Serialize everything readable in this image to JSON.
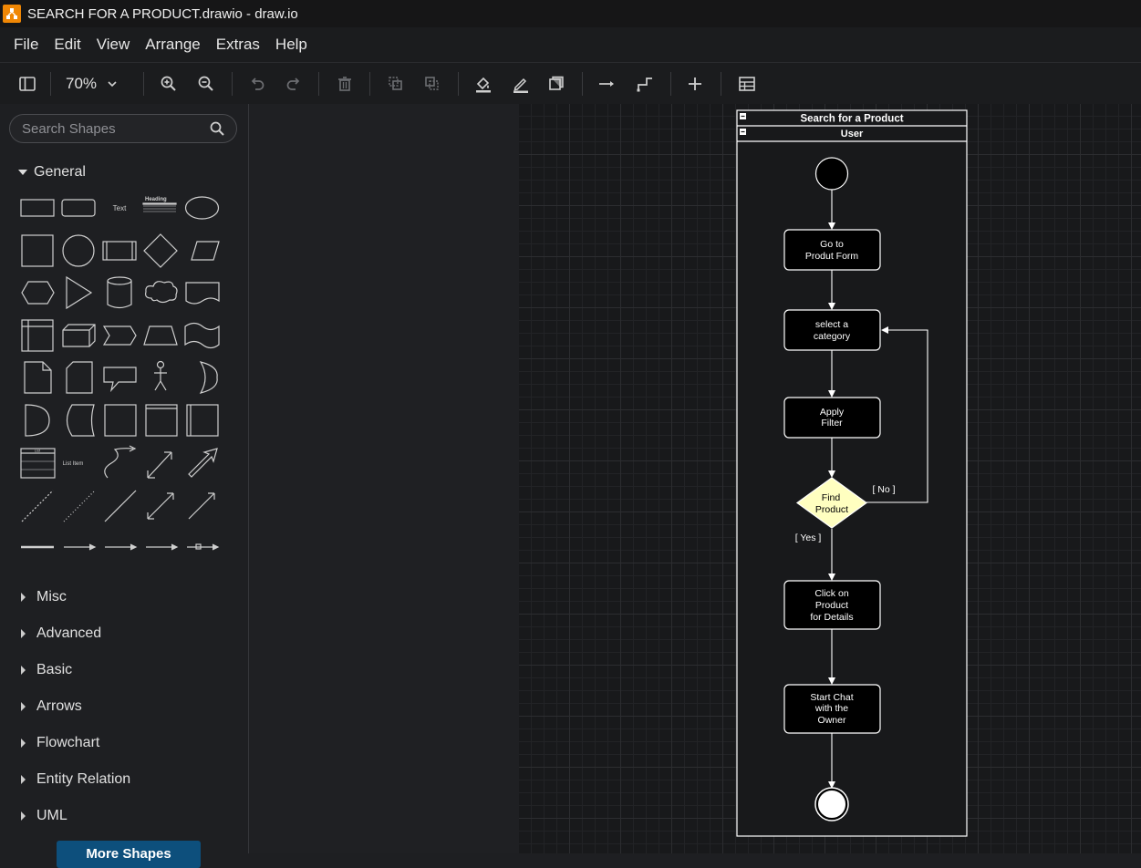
{
  "window": {
    "title": "SEARCH FOR A PRODUCT.drawio - draw.io"
  },
  "menu": [
    "File",
    "Edit",
    "View",
    "Arrange",
    "Extras",
    "Help"
  ],
  "toolbar": {
    "zoom": "70%"
  },
  "sidebar": {
    "search_placeholder": "Search Shapes",
    "general_label": "General",
    "shape_labels": {
      "text": "Text",
      "heading": "Heading",
      "list": "List",
      "list_item": "List Item"
    },
    "sections": [
      "Misc",
      "Advanced",
      "Basic",
      "Arrows",
      "Flowchart",
      "Entity Relation",
      "UML"
    ],
    "more_shapes": "More Shapes"
  },
  "diagram": {
    "pool_title": "Search for a Product",
    "lane_title": "User",
    "nodes": {
      "n1": [
        "Go to",
        "Produt Form"
      ],
      "n2": [
        "select a",
        "category"
      ],
      "n3": [
        "Apply",
        "Filter"
      ],
      "decision": [
        "Find",
        "Product"
      ],
      "n4": [
        "Click on",
        "Product",
        "for Details"
      ],
      "n5": [
        "Start Chat",
        "with the",
        "Owner"
      ]
    },
    "edge_labels": {
      "no": "[ No ]",
      "yes": "[ Yes ]"
    },
    "colors": {
      "decision_fill": "#ffffc0",
      "stroke": "#ffffff",
      "canvas": "#18191b"
    }
  }
}
